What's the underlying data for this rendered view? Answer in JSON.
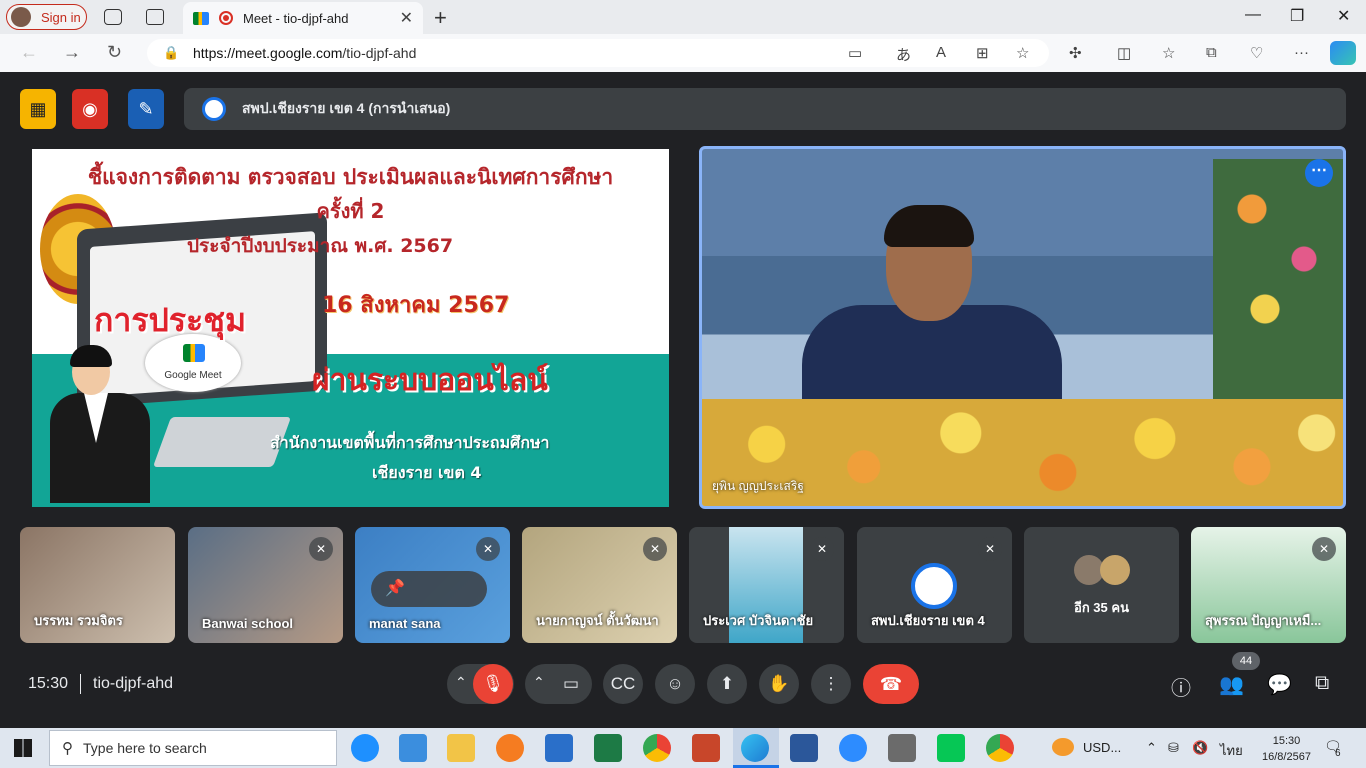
{
  "browser": {
    "signin_label": "Sign in",
    "tab_title": "Meet - tio-djpf-ahd",
    "url_domain": "https://meet.google.com",
    "url_path": "/tio-djpf-ahd"
  },
  "presentation": {
    "title": "สพป.เชียงราย เขต 4 (การนำเสนอ)"
  },
  "slide": {
    "line1": "ชี้แจงการติดตาม ตรวจสอบ ประเมินผลและนิเทศการศึกษา",
    "line2": "ครั้งที่ 2",
    "line3": "ประจำปีงบประมาณ พ.ศ. 2567",
    "date": "16 สิงหาคม 2567",
    "meeting": "การประชุม",
    "online": "ผ่านระบบออนไลน์",
    "office1": "สำนักงานเขตพื้นที่การศึกษาประถมศึกษา",
    "office2": "เชียงราย เขต 4",
    "google_meet": "Google Meet"
  },
  "speaker": {
    "name": "ยุพิน ญญประเสริฐ"
  },
  "tiles": [
    {
      "name": "บรรทม รวมจิตร"
    },
    {
      "name": "Banwai school"
    },
    {
      "name": "manat sana"
    },
    {
      "name": "นายกาญจน์ ตั้นวัฒนา"
    },
    {
      "name": "ประเวศ บัวจินดาชัย"
    },
    {
      "name": "สพป.เชียงราย เขต 4"
    },
    {
      "name": "อีก 35 คน"
    },
    {
      "name": "สุพรรณ ปัญญาเหมื..."
    }
  ],
  "controls": {
    "time": "15:30",
    "meeting_code": "tio-djpf-ahd",
    "participant_count": "44"
  },
  "taskbar": {
    "search_placeholder": "Type here to search",
    "weather": "USD...",
    "lang": "ไทย",
    "clock_time": "15:30",
    "clock_date": "16/8/2567",
    "notifications": "6"
  }
}
